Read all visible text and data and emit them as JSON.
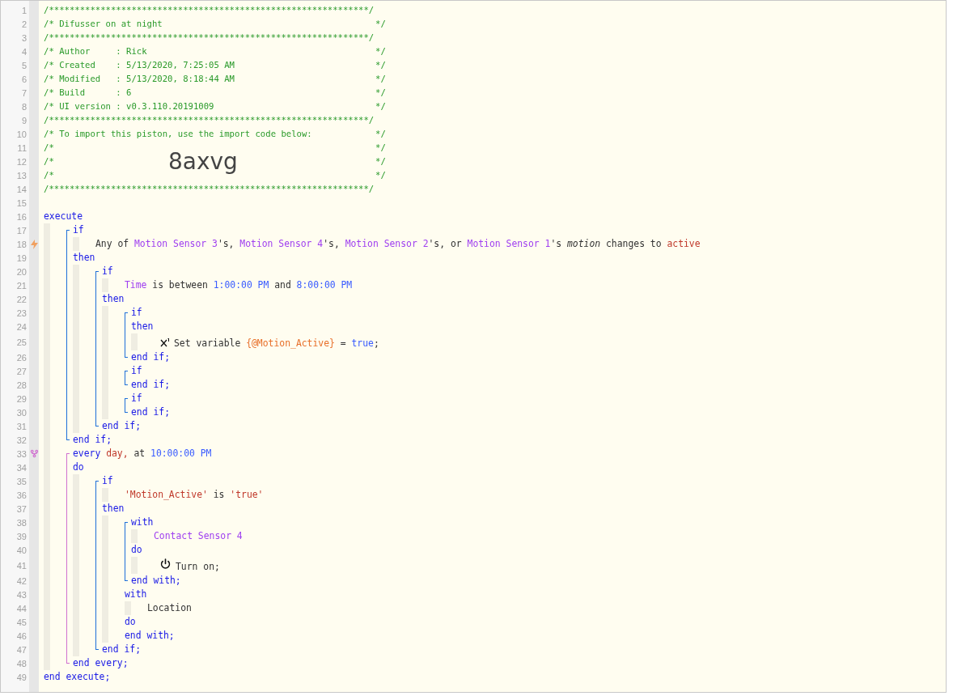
{
  "line_numbers": [
    "1",
    "2",
    "3",
    "4",
    "5",
    "6",
    "7",
    "8",
    "9",
    "10",
    "11",
    "12",
    "13",
    "14",
    "15",
    "16",
    "17",
    "18",
    "19",
    "20",
    "21",
    "22",
    "23",
    "24",
    "25",
    "26",
    "27",
    "28",
    "29",
    "30",
    "31",
    "32",
    "33",
    "34",
    "35",
    "36",
    "37",
    "38",
    "39",
    "40",
    "41",
    "42",
    "43",
    "44",
    "45",
    "46",
    "47",
    "48",
    "49"
  ],
  "header": [
    {
      "kind": "comment",
      "text": "/**************************************************************/"
    },
    {
      "kind": "comment",
      "text": "/* Difusser on at night",
      "end": "*/"
    },
    {
      "kind": "comment",
      "text": "/**************************************************************/"
    },
    {
      "kind": "comment",
      "text": "/* Author     : Rick",
      "end": "*/"
    },
    {
      "kind": "comment",
      "text": "/* Created    : 5/13/2020, 7:25:05 AM",
      "end": "*/"
    },
    {
      "kind": "comment",
      "text": "/* Modified   : 5/13/2020, 8:18:44 AM",
      "end": "*/"
    },
    {
      "kind": "comment",
      "text": "/* Build      : 6",
      "end": "*/"
    },
    {
      "kind": "comment",
      "text": "/* UI version : v0.3.110.20191009",
      "end": "*/"
    },
    {
      "kind": "comment",
      "text": "/**************************************************************/"
    },
    {
      "kind": "comment",
      "text": "/* To import this piston, use the import code below:",
      "end": "*/"
    },
    {
      "kind": "comment",
      "text": "/*",
      "end": "*/"
    },
    {
      "kind": "banner",
      "text": "/*",
      "code": "8axvg",
      "end": "*/"
    },
    {
      "kind": "comment",
      "text": "/*",
      "end": "*/"
    },
    {
      "kind": "comment",
      "text": "/**************************************************************/"
    },
    {
      "kind": "blank"
    }
  ],
  "code": [
    {
      "kind": "line",
      "tokens": [
        {
          "text": "execute",
          "kind": "keyword"
        }
      ],
      "children": [
        {
          "kind": "block",
          "color": "#1e6fd9",
          "items": [
            {
              "kind": "line",
              "tokens": [
                {
                  "text": "if",
                  "kind": "keyword"
                }
              ],
              "children": [
                {
                  "kind": "trigger",
                  "tokens": [
                    {
                      "text": "Any of ",
                      "kind": "plain"
                    },
                    {
                      "text": "Motion Sensor 3",
                      "kind": "device"
                    },
                    {
                      "text": "'s, ",
                      "kind": "plain"
                    },
                    {
                      "text": "Motion Sensor 4",
                      "kind": "device"
                    },
                    {
                      "text": "'s, ",
                      "kind": "plain"
                    },
                    {
                      "text": "Motion Sensor 2",
                      "kind": "device"
                    },
                    {
                      "text": "'s, or ",
                      "kind": "plain"
                    },
                    {
                      "text": "Motion Sensor 1",
                      "kind": "device"
                    },
                    {
                      "text": "'s ",
                      "kind": "plain"
                    },
                    {
                      "text": "motion",
                      "kind": "italic"
                    },
                    {
                      "text": " changes to ",
                      "kind": "plain"
                    },
                    {
                      "text": "active",
                      "kind": "literal"
                    }
                  ]
                }
              ]
            },
            {
              "kind": "line",
              "tokens": [
                {
                  "text": "then",
                  "kind": "keyword"
                }
              ],
              "children": [
                {
                  "kind": "block",
                  "color": "#1e6fd9",
                  "items": [
                    {
                      "kind": "line",
                      "tokens": [
                        {
                          "text": "if",
                          "kind": "keyword"
                        }
                      ],
                      "children": [
                        {
                          "kind": "line",
                          "tokens": [
                            {
                              "text": "Time",
                              "kind": "device"
                            },
                            {
                              "text": " is between ",
                              "kind": "plain"
                            },
                            {
                              "text": "1:00:00 PM",
                              "kind": "value"
                            },
                            {
                              "text": " and ",
                              "kind": "plain"
                            },
                            {
                              "text": "8:00:00 PM",
                              "kind": "value"
                            }
                          ]
                        }
                      ]
                    },
                    {
                      "kind": "line",
                      "tokens": [
                        {
                          "text": "then",
                          "kind": "keyword"
                        }
                      ],
                      "children": [
                        {
                          "kind": "block",
                          "color": "#1e6fd9",
                          "items": [
                            {
                              "kind": "line",
                              "tokens": [
                                {
                                  "text": "if",
                                  "kind": "keyword"
                                }
                              ]
                            },
                            {
                              "kind": "line",
                              "tokens": [
                                {
                                  "text": "then",
                                  "kind": "keyword"
                                }
                              ],
                              "children": [
                                {
                                  "kind": "assign",
                                  "tokens": [
                                    {
                                      "text": "Set variable ",
                                      "kind": "plain"
                                    },
                                    {
                                      "text": "{@Motion_Active}",
                                      "kind": "variable"
                                    },
                                    {
                                      "text": " = ",
                                      "kind": "plain"
                                    },
                                    {
                                      "text": "true",
                                      "kind": "value"
                                    },
                                    {
                                      "text": ";",
                                      "kind": "plain"
                                    }
                                  ]
                                }
                              ]
                            },
                            {
                              "kind": "line",
                              "tokens": [
                                {
                                  "text": "end if;",
                                  "kind": "keyword"
                                }
                              ]
                            }
                          ]
                        },
                        {
                          "kind": "block",
                          "color": "#1e6fd9",
                          "items": [
                            {
                              "kind": "line",
                              "tokens": [
                                {
                                  "text": "if",
                                  "kind": "keyword"
                                }
                              ]
                            },
                            {
                              "kind": "line",
                              "tokens": [
                                {
                                  "text": "end if;",
                                  "kind": "keyword"
                                }
                              ]
                            }
                          ]
                        },
                        {
                          "kind": "block",
                          "color": "#1e6fd9",
                          "items": [
                            {
                              "kind": "line",
                              "tokens": [
                                {
                                  "text": "if",
                                  "kind": "keyword"
                                }
                              ]
                            },
                            {
                              "kind": "line",
                              "tokens": [
                                {
                                  "text": "end if;",
                                  "kind": "keyword"
                                }
                              ]
                            }
                          ]
                        }
                      ]
                    },
                    {
                      "kind": "line",
                      "tokens": [
                        {
                          "text": "end if;",
                          "kind": "keyword"
                        }
                      ]
                    }
                  ]
                }
              ]
            },
            {
              "kind": "line",
              "tokens": [
                {
                  "text": "end if;",
                  "kind": "keyword"
                }
              ]
            }
          ]
        },
        {
          "kind": "block",
          "color": "#d070d0",
          "items": [
            {
              "kind": "timer",
              "tokens": [
                {
                  "text": "every",
                  "kind": "keyword"
                },
                {
                  "text": " day,",
                  "kind": "literal"
                },
                {
                  "text": " at ",
                  "kind": "plain"
                },
                {
                  "text": "10:00:00 PM",
                  "kind": "value"
                }
              ]
            },
            {
              "kind": "line",
              "tokens": [
                {
                  "text": "do",
                  "kind": "keyword"
                }
              ],
              "children": [
                {
                  "kind": "block",
                  "color": "#1e6fd9",
                  "items": [
                    {
                      "kind": "line",
                      "tokens": [
                        {
                          "text": "if",
                          "kind": "keyword"
                        }
                      ],
                      "children": [
                        {
                          "kind": "line",
                          "tokens": [
                            {
                              "text": "'Motion_Active'",
                              "kind": "literal"
                            },
                            {
                              "text": " is ",
                              "kind": "plain"
                            },
                            {
                              "text": "'true'",
                              "kind": "literal"
                            }
                          ]
                        }
                      ]
                    },
                    {
                      "kind": "line",
                      "tokens": [
                        {
                          "text": "then",
                          "kind": "keyword"
                        }
                      ],
                      "children": [
                        {
                          "kind": "block",
                          "color": "#1e6fd9",
                          "items": [
                            {
                              "kind": "line",
                              "tokens": [
                                {
                                  "text": "with",
                                  "kind": "keyword"
                                }
                              ],
                              "children": [
                                {
                                  "kind": "line",
                                  "tokens": [
                                    {
                                      "text": "Contact Sensor 4",
                                      "kind": "device"
                                    }
                                  ]
                                }
                              ]
                            },
                            {
                              "kind": "line",
                              "tokens": [
                                {
                                  "text": "do",
                                  "kind": "keyword"
                                }
                              ],
                              "children": [
                                {
                                  "kind": "command",
                                  "tokens": [
                                    {
                                      "text": "Turn on;",
                                      "kind": "plain"
                                    }
                                  ]
                                }
                              ]
                            },
                            {
                              "kind": "line",
                              "tokens": [
                                {
                                  "text": "end with;",
                                  "kind": "keyword"
                                }
                              ]
                            }
                          ]
                        },
                        {
                          "kind": "line",
                          "tokens": [
                            {
                              "text": "with",
                              "kind": "keyword"
                            }
                          ],
                          "children": [
                            {
                              "kind": "line",
                              "tokens": [
                                {
                                  "text": "Location",
                                  "kind": "plain"
                                }
                              ]
                            }
                          ]
                        },
                        {
                          "kind": "line",
                          "tokens": [
                            {
                              "text": "do",
                              "kind": "keyword"
                            }
                          ]
                        },
                        {
                          "kind": "line",
                          "tokens": [
                            {
                              "text": "end with;",
                              "kind": "keyword"
                            }
                          ]
                        }
                      ]
                    },
                    {
                      "kind": "line",
                      "tokens": [
                        {
                          "text": "end if;",
                          "kind": "keyword"
                        }
                      ]
                    }
                  ]
                }
              ]
            },
            {
              "kind": "line",
              "tokens": [
                {
                  "text": "end every;",
                  "kind": "keyword"
                }
              ]
            }
          ]
        }
      ]
    },
    {
      "kind": "line",
      "tokens": [
        {
          "text": "end execute;",
          "kind": "keyword"
        }
      ]
    }
  ]
}
